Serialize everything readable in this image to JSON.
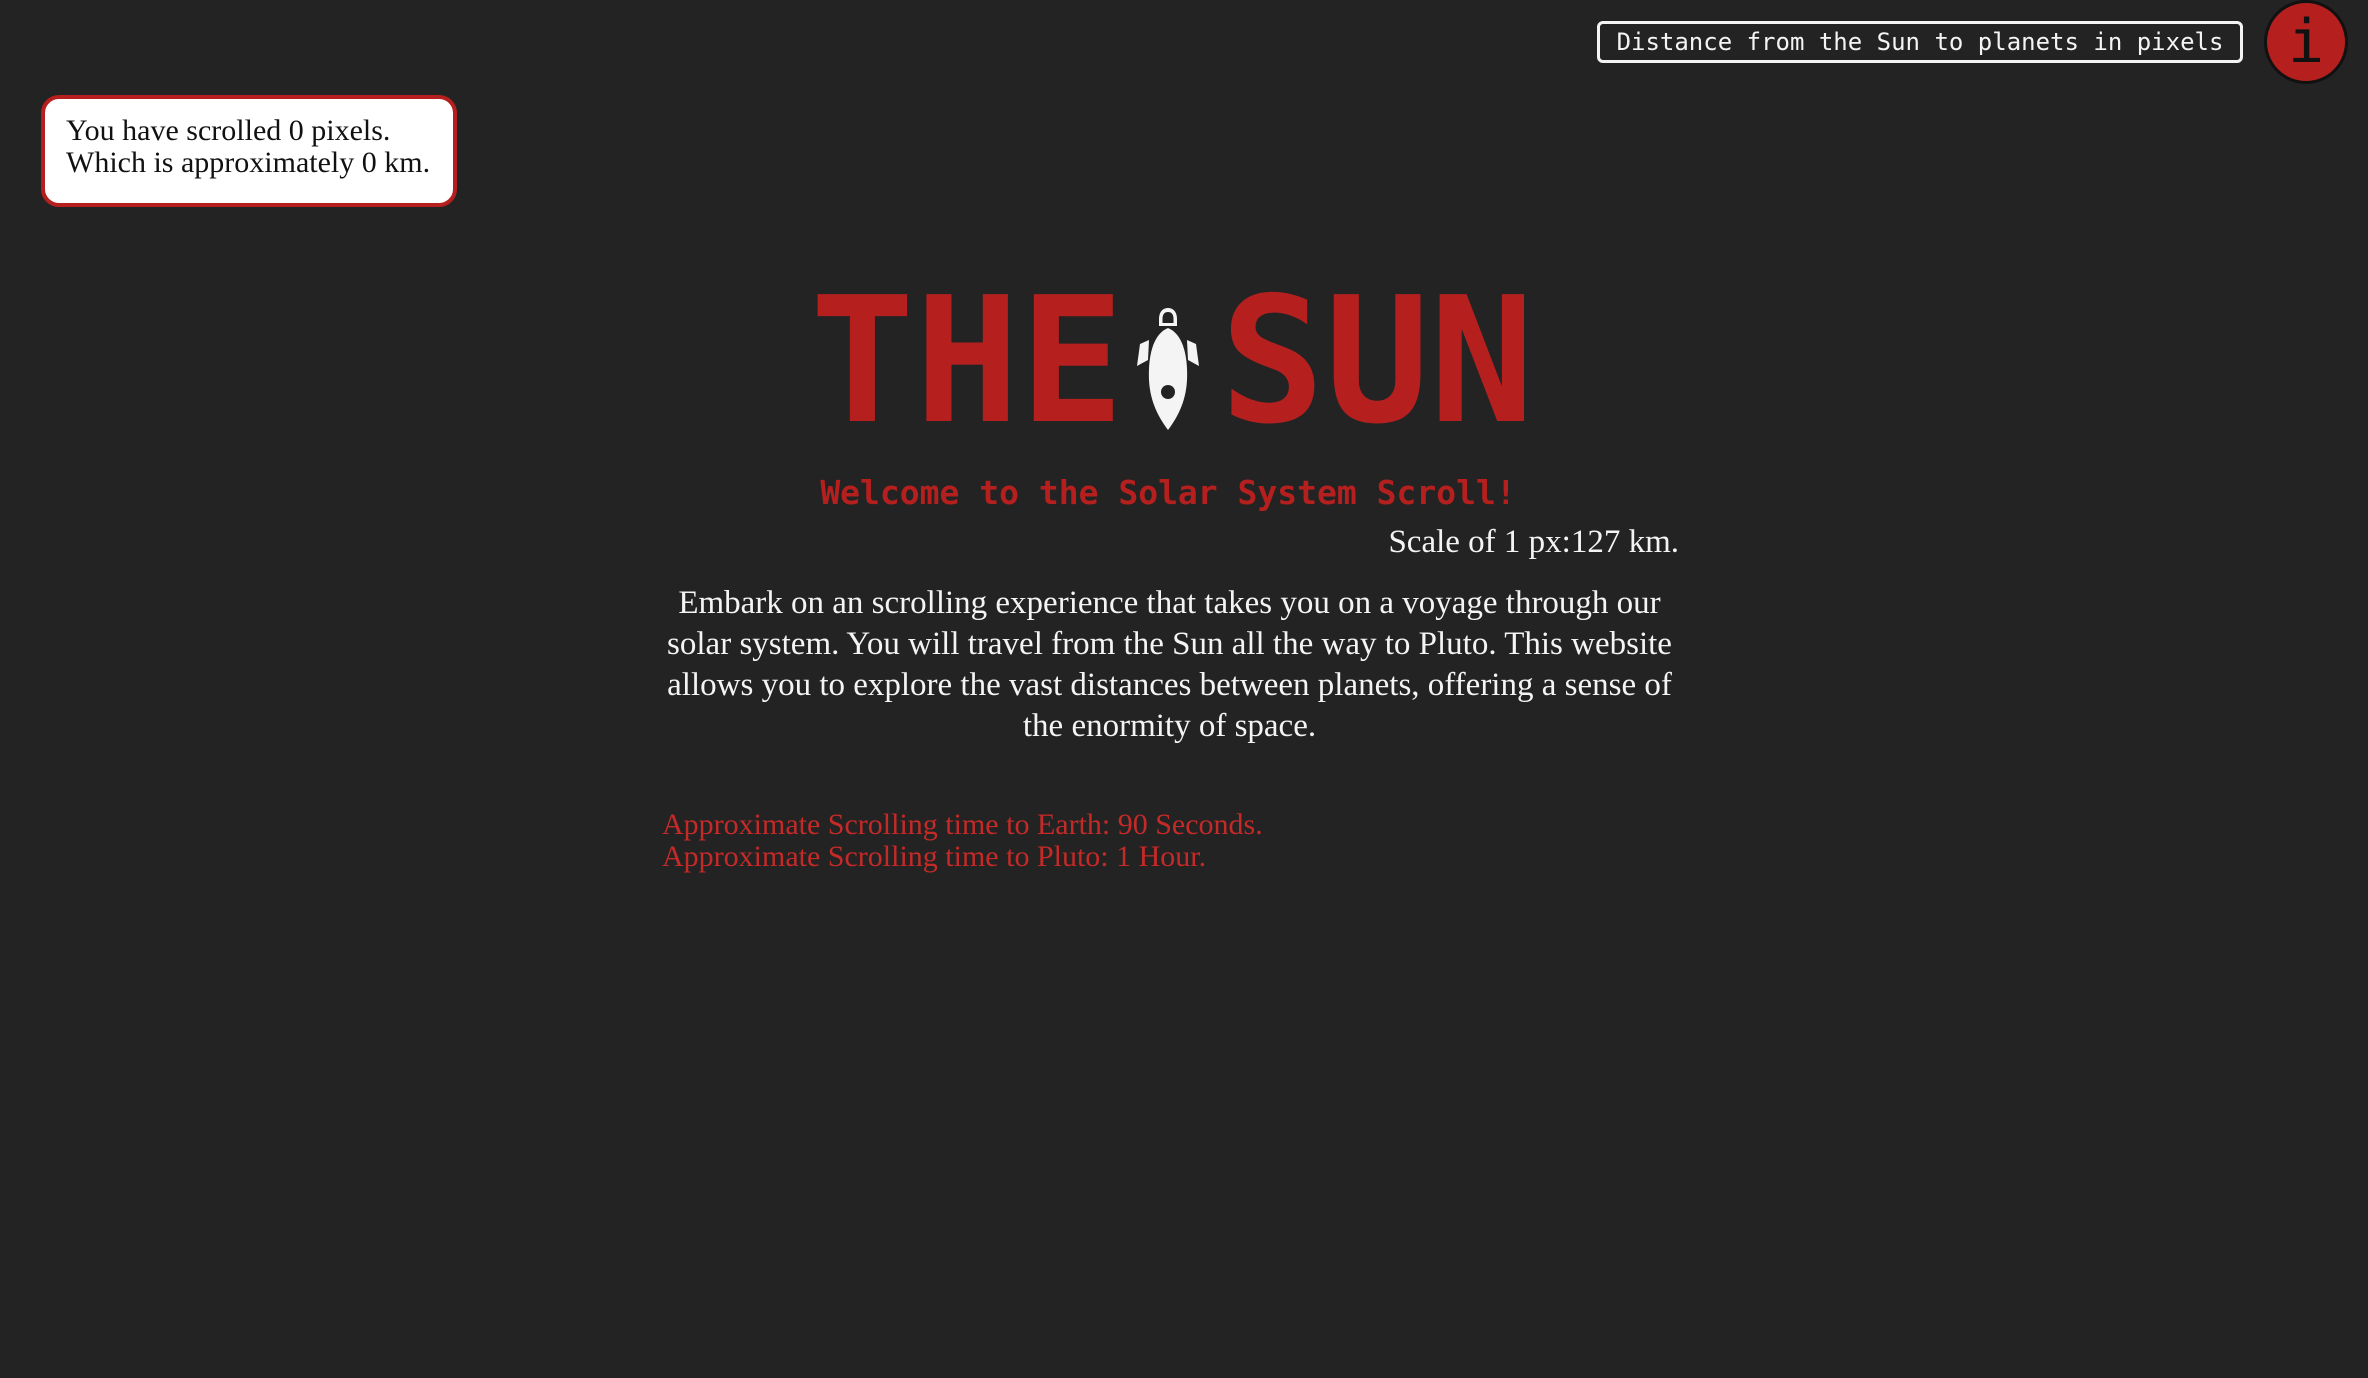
{
  "scroll_counter": {
    "line1": "You have scrolled 0 pixels.",
    "line2": "Which is approximately 0 km."
  },
  "planet_select": {
    "selected": "Distance from the Sun to planets in pixels"
  },
  "info_button": {
    "label": "i",
    "icon": "info-icon"
  },
  "hero": {
    "title_left": "THE",
    "title_right": "SUN",
    "title_icon": "rocket-icon",
    "welcome": "Welcome to the Solar System Scroll!",
    "scale": "Scale of 1 px:127 km.",
    "intro": "Embark on an scrolling experience that takes you on a voyage through our solar system. You will travel from the Sun all the way to Pluto. This website allows you to explore the vast distances between planets, offering a sense of the enormity of space.",
    "time_earth": "Approximate Scrolling time to Earth: 90 Seconds.",
    "time_pluto": "Approximate Scrolling time to Pluto: 1 Hour."
  },
  "colors": {
    "background": "#232323",
    "accent": "#b5201f",
    "text": "#f4f4f4"
  }
}
